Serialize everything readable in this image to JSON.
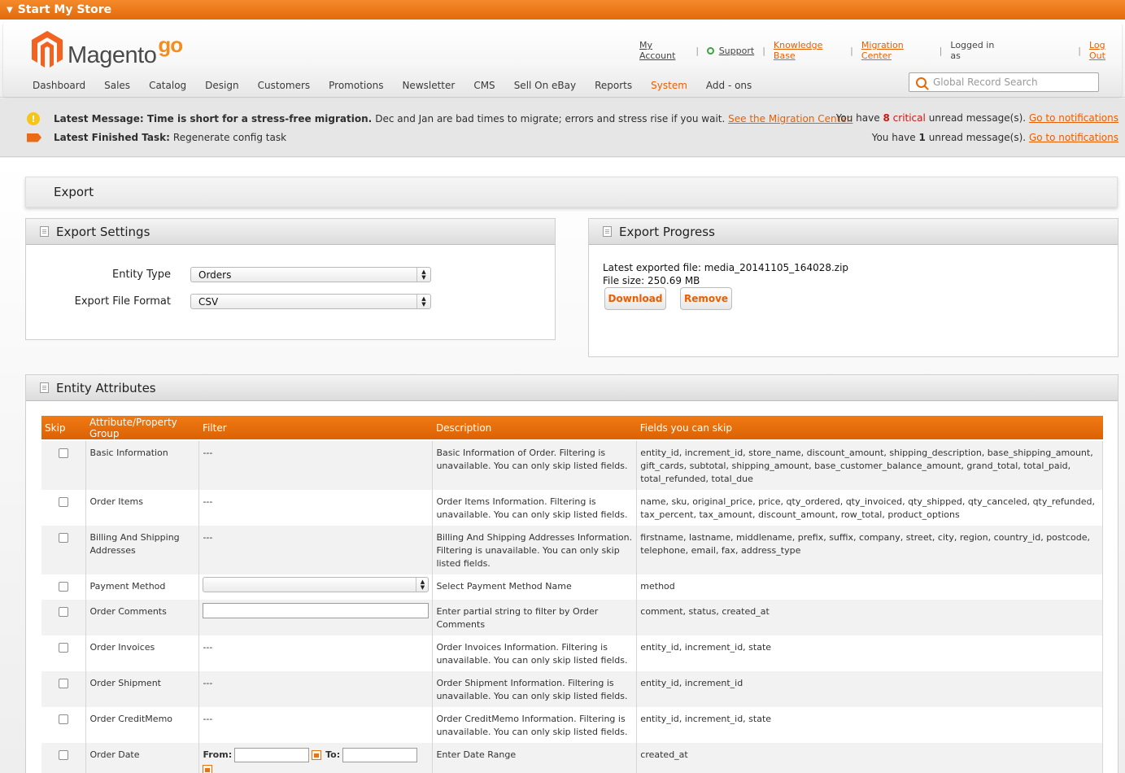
{
  "topbar": {
    "title": "Start My Store"
  },
  "logo": {
    "word": "Magento",
    "suffix": "go"
  },
  "toplinks": {
    "my_account": "My Account",
    "support": "Support",
    "knowledge_base": "Knowledge Base",
    "migration_center": "Migration Center",
    "logged_in": "Logged in as",
    "logout": "Log Out"
  },
  "nav": [
    "Dashboard",
    "Sales",
    "Catalog",
    "Design",
    "Customers",
    "Promotions",
    "Newsletter",
    "CMS",
    "Sell On eBay",
    "Reports",
    "System",
    "Add - ons"
  ],
  "nav_active": "System",
  "search": {
    "placeholder": "Global Record Search"
  },
  "messages": {
    "latest_label": "Latest Message: Time is short for a stress-free migration.",
    "latest_text": "Dec and Jan are bad times to migrate; errors and stress rise if you wait.",
    "latest_link": "See the Migration Center.",
    "task_label": "Latest Finished Task:",
    "task_text": "Regenerate config task",
    "critical_pre": "You have",
    "critical_count": "8",
    "critical_word": "critical",
    "critical_post": "unread message(s).",
    "unread_pre": "You have",
    "unread_count": "1",
    "unread_post": "unread message(s).",
    "goto": "Go to notifications"
  },
  "page": {
    "title": "Export"
  },
  "export_settings": {
    "title": "Export Settings",
    "entity_type_label": "Entity Type",
    "entity_type_value": "Orders",
    "format_label": "Export File Format",
    "format_value": "CSV"
  },
  "export_progress": {
    "title": "Export Progress",
    "latest_file": "Latest exported file: media_20141105_164028.zip",
    "file_size": "File size: 250.69 MB",
    "download": "Download",
    "remove": "Remove"
  },
  "attributes": {
    "title": "Entity Attributes",
    "columns": [
      "Skip",
      "Attribute/Property Group",
      "Filter",
      "Description",
      "Fields you can skip"
    ],
    "rows": [
      {
        "group": "Basic Information",
        "filter": "---",
        "description": "Basic Information of Order. Filtering is unavailable. You can only skip listed fields.",
        "fields": "entity_id, increment_id, store_name, discount_amount, shipping_description, base_shipping_amount, gift_cards, subtotal, shipping_amount, base_customer_balance_amount, grand_total, total_paid, total_refunded, total_due"
      },
      {
        "group": "Order Items",
        "filter": "---",
        "description": "Order Items Information. Filtering is unavailable. You can only skip listed fields.",
        "fields": "name, sku, original_price, price, qty_ordered, qty_invoiced, qty_shipped, qty_canceled, qty_refunded, tax_percent, tax_amount, discount_amount, row_total, product_options"
      },
      {
        "group": "Billing And Shipping Addresses",
        "filter": "---",
        "description": "Billing And Shipping Addresses Information. Filtering is unavailable. You can only skip listed fields.",
        "fields": "firstname, lastname, middlename, prefix, suffix, company, street, city, region, country_id, postcode, telephone, email, fax, address_type"
      },
      {
        "group": "Payment Method",
        "filter": "",
        "description": "Select Payment Method Name",
        "fields": "method"
      },
      {
        "group": "Order Comments",
        "filter": "",
        "description": "Enter partial string to filter by Order Comments",
        "fields": "comment, status, created_at"
      },
      {
        "group": "Order Invoices",
        "filter": "---",
        "description": "Order Invoices Information. Filtering is unavailable. You can only skip listed fields.",
        "fields": "entity_id, increment_id, state"
      },
      {
        "group": "Order Shipment",
        "filter": "---",
        "description": "Order Shipment Information. Filtering is unavailable. You can only skip listed fields.",
        "fields": "entity_id, increment_id"
      },
      {
        "group": "Order CreditMemo",
        "filter": "---",
        "description": "Order CreditMemo Information. Filtering is unavailable. You can only skip listed fields.",
        "fields": "entity_id, increment_id, state"
      },
      {
        "group": "Order Date",
        "filter": "",
        "description": "Enter Date Range",
        "fields": "created_at"
      }
    ],
    "date_from": "From:",
    "date_to": "To:"
  },
  "colors": {
    "accent": "#eb5e00",
    "header_orange": "#e26a0b",
    "critical": "#c81717"
  }
}
